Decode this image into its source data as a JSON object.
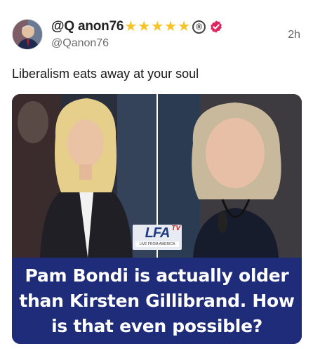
{
  "post": {
    "display_name": "@Q anon76",
    "badges": {
      "stars": [
        "★",
        "★",
        "★",
        "★",
        "★"
      ],
      "registered": "®",
      "verified_icon": "verified-badge-icon"
    },
    "handle": "@Qanon76",
    "timestamp": "2h",
    "text": "Liberalism eats away at your soul"
  },
  "media": {
    "logo_text": "LFA",
    "logo_tv": "TV",
    "logo_subtitle": "LIVE FROM AMERICA",
    "caption": "Pam Bondi is actually older than Kirsten Gillibrand. How is that even possible?"
  },
  "colors": {
    "star": "#f7c325",
    "verified": "#e0245e",
    "caption_bg": "#1f2c7a"
  }
}
